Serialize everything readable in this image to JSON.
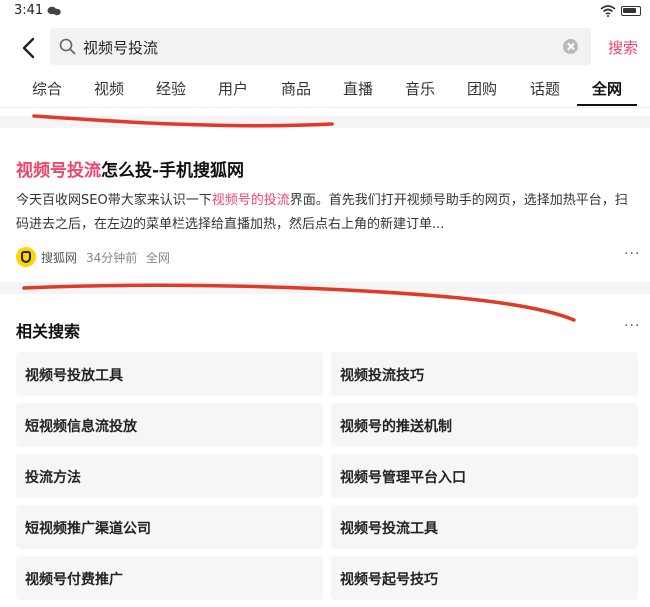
{
  "status": {
    "time": "3:41",
    "icons": [
      "chat-icon",
      "wifi-icon",
      "battery-icon"
    ]
  },
  "search": {
    "query": "视频号投流",
    "button_label": "搜索"
  },
  "tabs": [
    {
      "label": "综合",
      "active": false
    },
    {
      "label": "视频",
      "active": false
    },
    {
      "label": "经验",
      "active": false
    },
    {
      "label": "用户",
      "active": false
    },
    {
      "label": "商品",
      "active": false
    },
    {
      "label": "直播",
      "active": false
    },
    {
      "label": "音乐",
      "active": false
    },
    {
      "label": "团购",
      "active": false
    },
    {
      "label": "话题",
      "active": false
    },
    {
      "label": "全网",
      "active": true
    }
  ],
  "result": {
    "title_highlight": "视频号投流",
    "title_rest": "怎么投-手机搜狐网",
    "snippet_before": "今天百收网SEO带大家来认识一下",
    "snippet_highlight": "视频号的投流",
    "snippet_after": "界面。首先我们打开视频号助手的网页，选择加热平台，扫码进去之后，在左边的菜单栏选择给直播加热，然后点右上角的新建订单...",
    "source": "搜狐网",
    "time": "34分钟前",
    "scope": "全网",
    "more": "···"
  },
  "related": {
    "title": "相关搜索",
    "more": "···",
    "items": [
      "视频号投放工具",
      "视频投流技巧",
      "短视频信息流投放",
      "视频号的推送机制",
      "投流方法",
      "视频号管理平台入口",
      "短视频推广渠道公司",
      "视频号投流工具",
      "视频号付费推广",
      "视频号起号技巧"
    ]
  },
  "colors": {
    "accent": "#f0466b",
    "annotation_red": "#e03a26",
    "tile_bg": "#f6f6f6"
  }
}
